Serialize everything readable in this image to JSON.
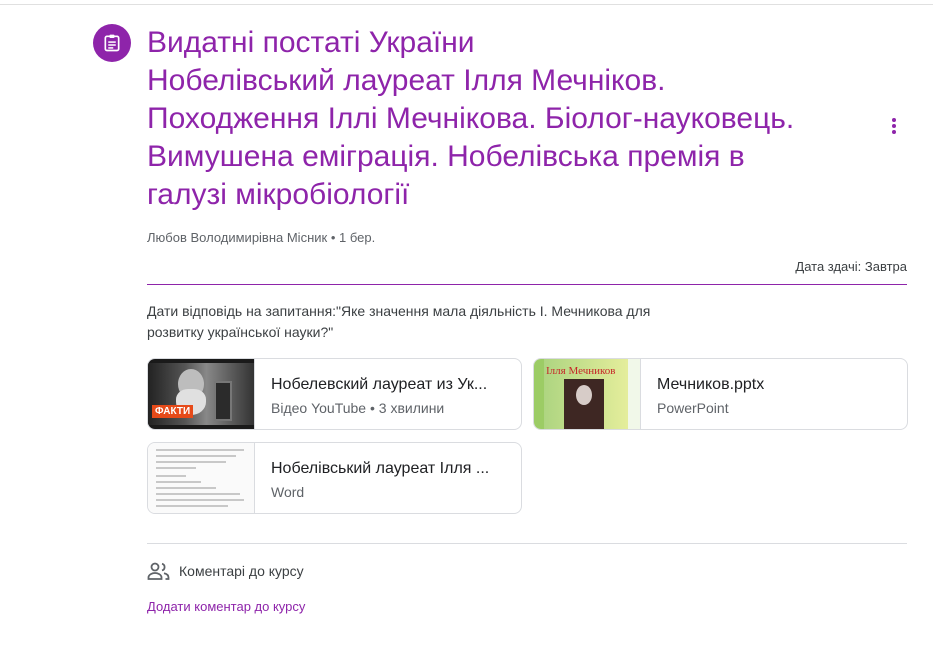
{
  "assignment": {
    "title_lines": [
      "Видатні постаті України",
      "Нобелівський лауреат Ілля Мечніков.",
      "Походження Іллі Мечнікова. Біолог-науковець.",
      "Вимушена еміграція. Нобелівська премія в",
      "галузі мікробіології"
    ],
    "author": "Любов Володимирівна Місник",
    "date": "1 бер.",
    "meta_sep": " • ",
    "due": "Дата здачі: Завтра",
    "description": "Дати відповідь на запитання:\"Яке значення мала діяльність І. Мечникова для розвитку української науки?\""
  },
  "attachments": [
    {
      "name": "Нобелевский лауреат из Ук...",
      "sub": "Відео YouTube • 3 хвилини",
      "thumb_label": "ФАКТИ"
    },
    {
      "name": "Мечников.pptx",
      "sub": "PowerPoint",
      "thumb_title": "Ілля Мечников"
    },
    {
      "name": "Нобелівський лауреат Ілля ...",
      "sub": "Word"
    }
  ],
  "comments": {
    "heading": "Коментарі до курсу",
    "add_link": "Додати коментар до курсу"
  },
  "colors": {
    "accent": "#8e24aa",
    "divider": "#dadce0"
  },
  "icons": {
    "assignment": "assignment-icon",
    "more": "more-vert-icon",
    "people": "people-icon"
  }
}
